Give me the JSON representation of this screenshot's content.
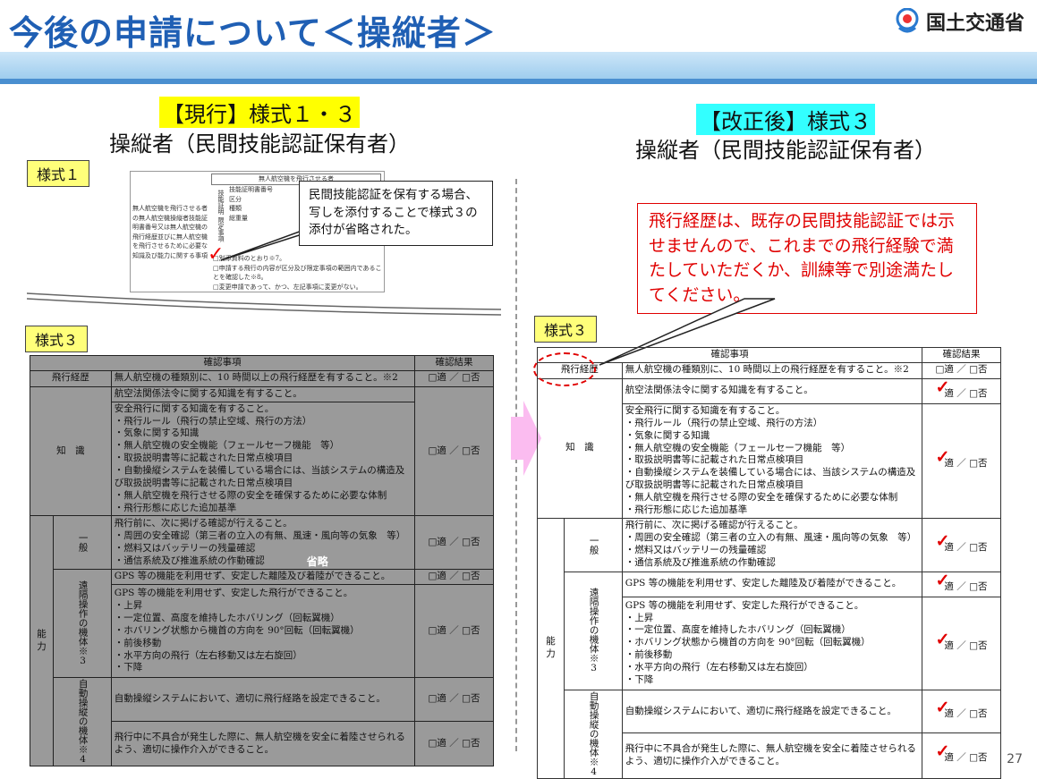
{
  "header": {
    "title": "今後の申請について＜操縦者＞",
    "logo_text": "国土交通省",
    "colors": {
      "title": "#1f5fb4",
      "accent": "#4a8fd0",
      "highlight_yellow": "#ffff00",
      "highlight_cyan": "#33ffff"
    }
  },
  "left": {
    "tag": "【現行】",
    "heading": "様式１・３",
    "subheading": "操縦者（民間技能認証保有者）",
    "label_form1": "様式１",
    "label_form3": "様式３",
    "form1_snippet": {
      "header": "無人航空機を飛行させる者",
      "left_text": "無人航空機を飛行させる者の無人航空機操縦者技能証明書番号又は無人航空機の飛行経歴並びに無人航空機を飛行させるために必要な知識及び能力に関する事項",
      "side_text": "技能証明 限定事項",
      "rows": [
        "技能証明書番号",
        "区分",
        "種類",
        "総重量"
      ],
      "bottom_lines": [
        "□別添資料のとおり※7。",
        "□申請する飛行の内容が区分及び限定事項の範囲内であることを確認した※8。",
        "□変更申請であって、かつ、左記事項に変更がない。"
      ]
    },
    "callout": "民間技能認証を保有する場合、写しを添付することで様式３の添付が省略された。",
    "omitted_label": "省略"
  },
  "right": {
    "tag": "【改正後】",
    "heading": "様式３",
    "subheading": "操縦者（民間技能認証保有者）",
    "label_form3": "様式３",
    "callout": "飛行経歴は、既存の民間技能認証では示せませんので、これまでの飛行経験で満たしていただくか、訓練等で別途満たしてください。"
  },
  "table": {
    "col_item": "確認事項",
    "col_result": "確認結果",
    "result_text": "□適 ／ □否",
    "result_text_checked": "適 ／ □否",
    "cat_flight": "飛行経歴",
    "cat_knowledge": "知　識",
    "cat_ability": "能\n力",
    "sub_general": "一般",
    "sub_remote": "遠隔操作の機体※3",
    "sub_auto": "自動操縦の機体",
    "sub_auto_note": "※4",
    "rows": {
      "flight": "無人航空機の種類別に、10 時間以上の飛行経歴を有すること。※2",
      "law": "航空法関係法令に関する知識を有すること。",
      "safety": "安全飛行に関する知識を有すること。\n・飛行ルール（飛行の禁止空域、飛行の方法）\n・気象に関する知識\n・無人航空機の安全機能（フェールセーフ機能　等）\n・取扱説明書等に記載された日常点検項目\n・自動操縦システムを装備している場合には、当該システムの構造及び取扱説明書等に記載された日常点検項目\n・無人航空機を飛行させる際の安全を確保するために必要な体制\n・飛行形態に応じた追加基準",
      "general": "飛行前に、次に掲げる確認が行えること。\n・周囲の安全確認（第三者の立入の有無、風速・風向等の気象　等）\n・燃料又はバッテリーの残量確認\n・通信系統及び推進系統の作動確認",
      "gps_landing": "GPS 等の機能を利用せず、安定した離陸及び着陸ができること。",
      "gps_flight": "GPS 等の機能を利用せず、安定した飛行ができること。\n・上昇\n・一定位置、高度を維持したホバリング（回転翼機）\n・ホバリング状態から機首の方向を 90°回転（回転翼機）\n・前後移動\n・水平方向の飛行（左右移動又は左右旋回）\n・下降",
      "auto_route": "自動操縦システムにおいて、適切に飛行経路を設定できること。",
      "auto_intervene": "飛行中に不具合が発生した際に、無人航空機を安全に着陸させられるよう、適切に操作介入ができること。"
    }
  },
  "page_number": "27"
}
